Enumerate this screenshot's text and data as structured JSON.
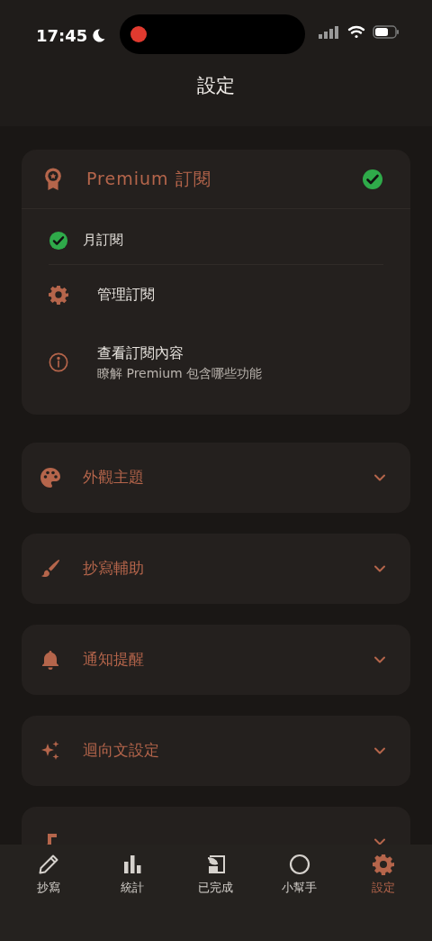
{
  "status_bar": {
    "time": "17:45"
  },
  "header": {
    "title": "設定"
  },
  "subscription": {
    "title": "Premium 訂閱",
    "active": true,
    "items": [
      {
        "kind": "status",
        "label": "月訂閱",
        "checked": true
      },
      {
        "kind": "link",
        "label": "管理訂閱"
      },
      {
        "kind": "link",
        "label": "查看訂閱內容",
        "subtitle": "瞭解 Premium 包含哪些功能"
      }
    ]
  },
  "sections": [
    {
      "label": "外觀主題",
      "expanded": false
    },
    {
      "label": "抄寫輔助",
      "expanded": false
    },
    {
      "label": "通知提醒",
      "expanded": false
    },
    {
      "label": "迴向文設定",
      "expanded": false
    },
    {
      "expanded": false
    }
  ],
  "tab_bar": [
    {
      "label": "抄寫",
      "selected": false
    },
    {
      "label": "統計",
      "selected": false
    },
    {
      "label": "已完成",
      "selected": false
    },
    {
      "label": "小幫手",
      "selected": false
    },
    {
      "label": "設定",
      "selected": true
    }
  ]
}
